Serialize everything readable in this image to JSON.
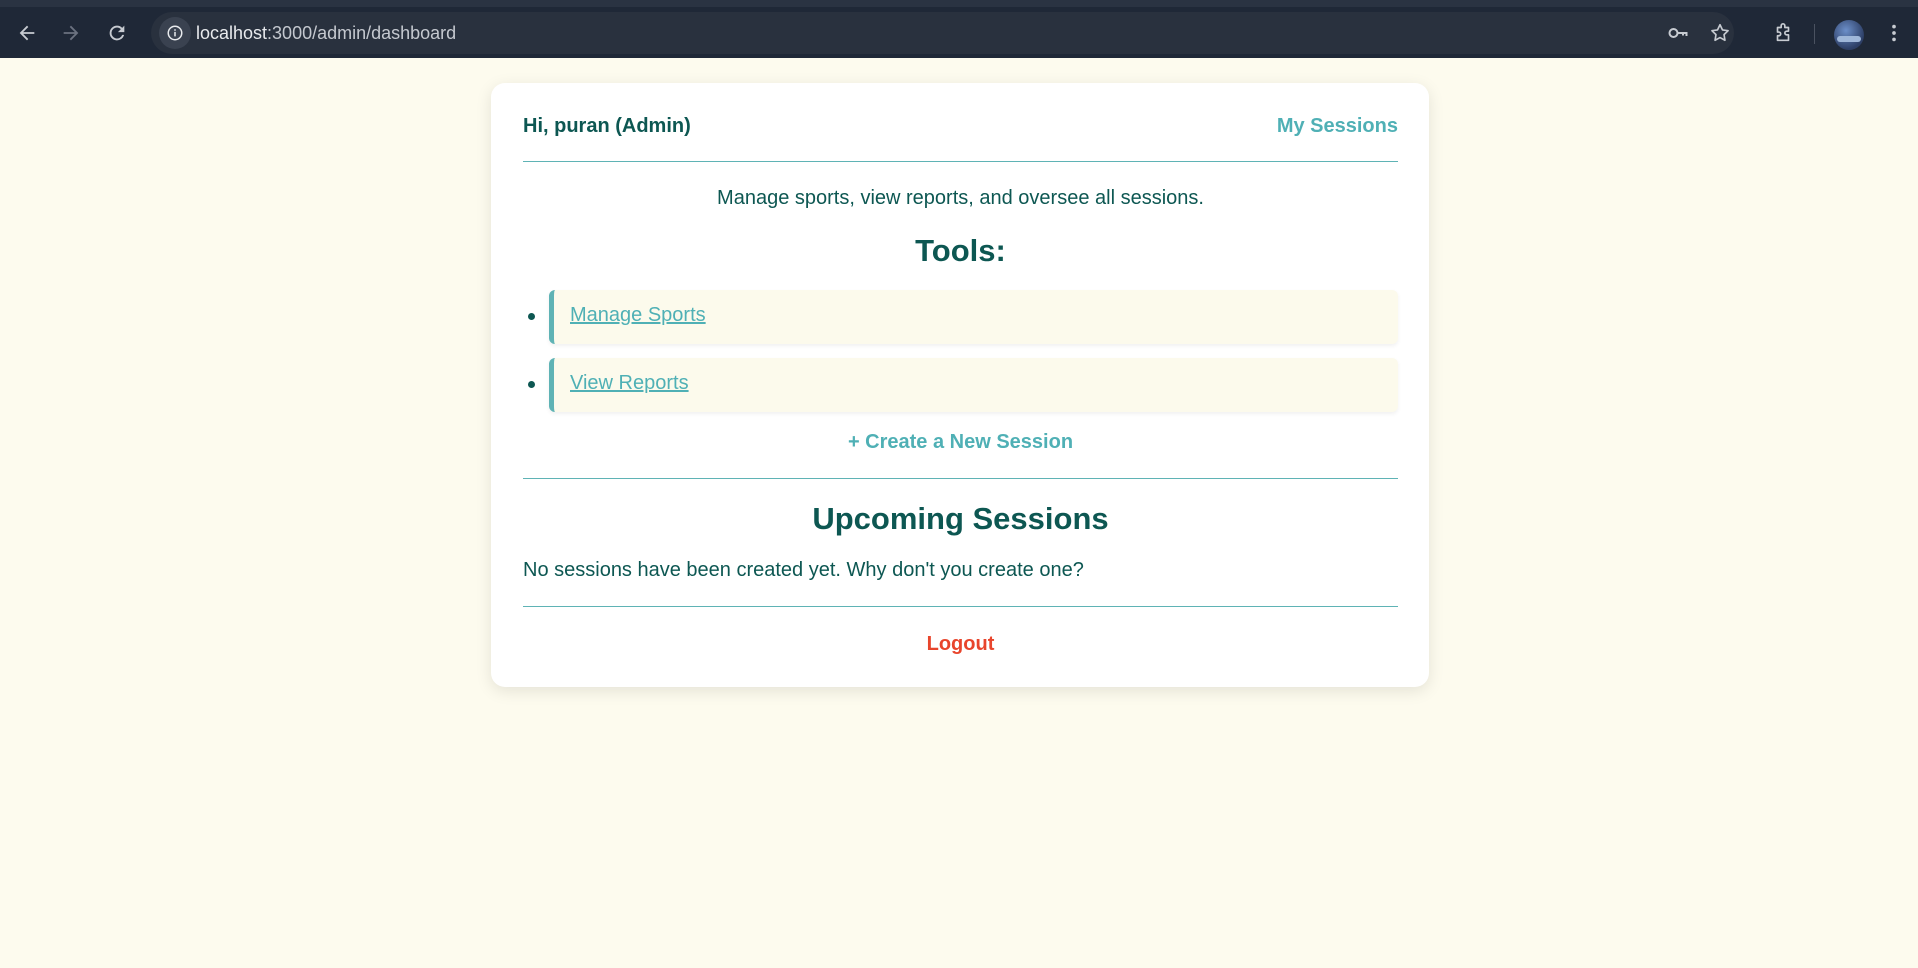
{
  "browser": {
    "url_host": "localhost",
    "url_path": ":3000/admin/dashboard"
  },
  "header": {
    "greeting": "Hi, puran (Admin)",
    "my_sessions_label": "My Sessions"
  },
  "intro": {
    "subtitle": "Manage sports, view reports, and oversee all sessions.",
    "tools_heading": "Tools:"
  },
  "tools": [
    {
      "label": "Manage Sports"
    },
    {
      "label": "View Reports"
    }
  ],
  "create_session_label": "+ Create a New Session",
  "upcoming": {
    "heading": "Upcoming Sessions",
    "empty_message": "No sessions have been created yet. Why don't you create one?"
  },
  "logout_label": "Logout",
  "colors": {
    "page_background": "#fdfbee",
    "primary_text": "#0d5752",
    "accent": "#4fb0b5",
    "danger": "#e8452c"
  }
}
